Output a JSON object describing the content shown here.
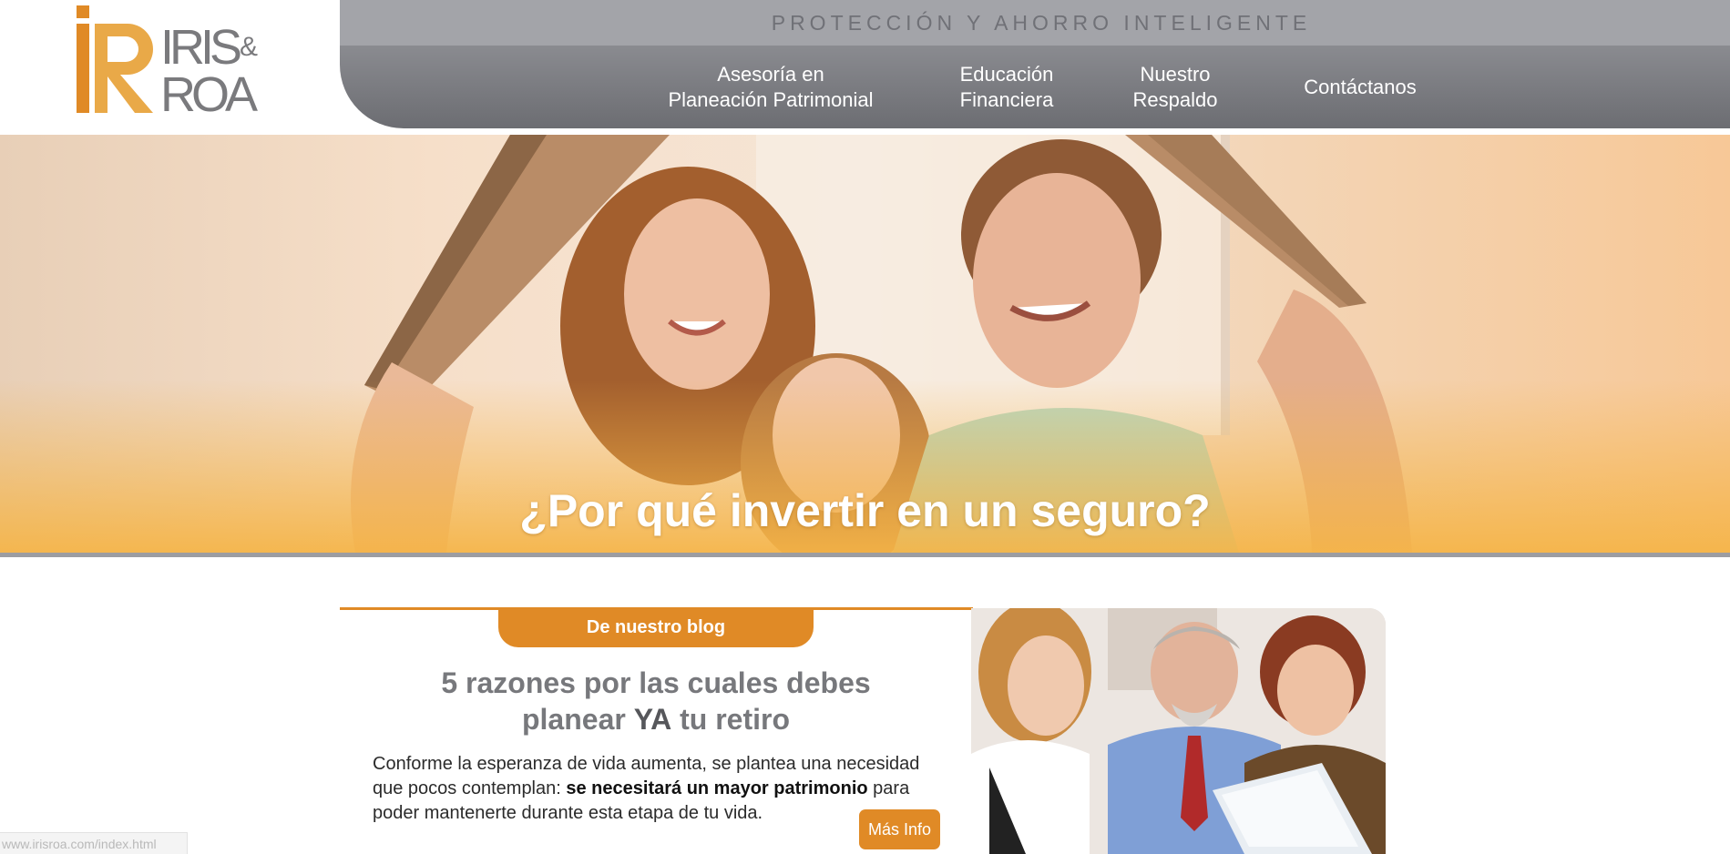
{
  "brand": {
    "logo_monogram": "iR",
    "logo_line1": "IRIS",
    "logo_amp": "&",
    "logo_line2": "ROA",
    "accent_color": "#e08a26",
    "gray_color": "#8a8b90"
  },
  "header": {
    "tagline": "PROTECCIÓN Y AHORRO INTELIGENTE"
  },
  "nav": {
    "items": [
      {
        "line1": "Asesoría en",
        "line2": "Planeación Patrimonial"
      },
      {
        "line1": "Educación",
        "line2": "Financiera"
      },
      {
        "line1": "Nuestro",
        "line2": "Respaldo"
      },
      {
        "line1": "Contáctanos",
        "line2": ""
      }
    ]
  },
  "hero": {
    "title": "¿Por qué invertir en un seguro?"
  },
  "blog": {
    "label": "De nuestro blog",
    "title_line1": "5 razones por las cuales debes",
    "title_line2_pre": "planear ",
    "title_line2_bold": "YA",
    "title_line2_post": " tu retiro",
    "body_pre": "Conforme la esperanza de vida aumenta, se plantea una necesidad que pocos contemplan: ",
    "body_bold": "se necesitará un mayor patrimonio",
    "body_post": " para poder mantenerte durante esta etapa de tu vida.",
    "more_label": "Más Info"
  },
  "status_bar": {
    "url": "www.irisroa.com/index.html"
  }
}
